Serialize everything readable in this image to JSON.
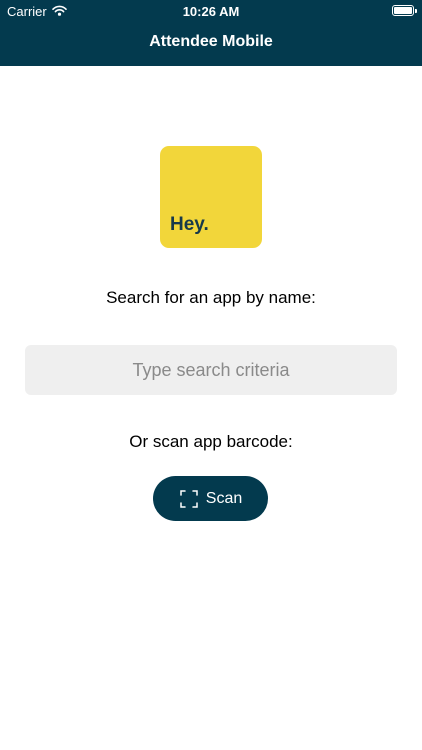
{
  "status_bar": {
    "carrier": "Carrier",
    "time": "10:26 AM",
    "icons": [
      "wifi-icon",
      "battery-icon"
    ]
  },
  "nav": {
    "title": "Attendee Mobile"
  },
  "logo": {
    "text": "Hey.",
    "background_color": "#f2d63a",
    "text_color": "#17394a"
  },
  "search": {
    "label": "Search for an app by name:",
    "value": "",
    "placeholder": "Type search criteria"
  },
  "scan": {
    "label": "Or scan app barcode:",
    "button_label": "Scan",
    "icon": "scan-frame-icon"
  },
  "colors": {
    "header": "#033a4e",
    "accent": "#033a4e",
    "input_background": "#efefef"
  }
}
